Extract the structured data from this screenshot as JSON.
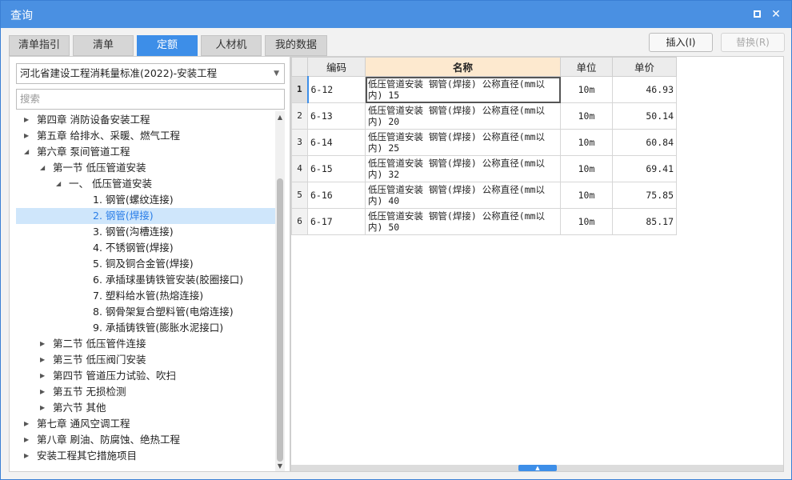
{
  "window": {
    "title": "查询"
  },
  "tabs": [
    {
      "label": "清单指引",
      "active": false
    },
    {
      "label": "清单",
      "active": false
    },
    {
      "label": "定额",
      "active": true
    },
    {
      "label": "人材机",
      "active": false
    },
    {
      "label": "我的数据",
      "active": false
    }
  ],
  "buttons": {
    "insert": "插入(I)",
    "replace": "替换(R)"
  },
  "standard_select": {
    "value": "河北省建设工程消耗量标准(2022)-安装工程"
  },
  "search": {
    "placeholder": "搜索"
  },
  "tree": [
    {
      "label": "第四章 消防设备安装工程",
      "level": 0,
      "arrow": "right",
      "selected": false
    },
    {
      "label": "第五章 给排水、采暖、燃气工程",
      "level": 0,
      "arrow": "right",
      "selected": false
    },
    {
      "label": "第六章 泵间管道工程",
      "level": 0,
      "arrow": "down",
      "selected": false
    },
    {
      "label": "第一节 低压管道安装",
      "level": 1,
      "arrow": "down",
      "selected": false
    },
    {
      "label": "一、 低压管道安装",
      "level": 2,
      "arrow": "down",
      "selected": false
    },
    {
      "label": "1. 钢管(螺纹连接)",
      "level": 3,
      "arrow": "",
      "selected": false
    },
    {
      "label": "2. 钢管(焊接)",
      "level": 3,
      "arrow": "",
      "selected": true
    },
    {
      "label": "3. 钢管(沟槽连接)",
      "level": 3,
      "arrow": "",
      "selected": false
    },
    {
      "label": "4. 不锈钢管(焊接)",
      "level": 3,
      "arrow": "",
      "selected": false
    },
    {
      "label": "5. 铜及铜合金管(焊接)",
      "level": 3,
      "arrow": "",
      "selected": false
    },
    {
      "label": "6. 承插球墨铸铁管安装(胶圈接口)",
      "level": 3,
      "arrow": "",
      "selected": false
    },
    {
      "label": "7. 塑料给水管(热熔连接)",
      "level": 3,
      "arrow": "",
      "selected": false
    },
    {
      "label": "8. 钢骨架复合塑料管(电熔连接)",
      "level": 3,
      "arrow": "",
      "selected": false
    },
    {
      "label": "9. 承插铸铁管(膨胀水泥接口)",
      "level": 3,
      "arrow": "",
      "selected": false
    },
    {
      "label": "第二节 低压管件连接",
      "level": 1,
      "arrow": "right",
      "selected": false
    },
    {
      "label": "第三节 低压阀门安装",
      "level": 1,
      "arrow": "right",
      "selected": false
    },
    {
      "label": "第四节 管道压力试验、吹扫",
      "level": 1,
      "arrow": "right",
      "selected": false
    },
    {
      "label": "第五节 无损检测",
      "level": 1,
      "arrow": "right",
      "selected": false
    },
    {
      "label": "第六节 其他",
      "level": 1,
      "arrow": "right",
      "selected": false
    },
    {
      "label": "第七章 通风空调工程",
      "level": 0,
      "arrow": "right",
      "selected": false
    },
    {
      "label": "第八章 刷油、防腐蚀、绝热工程",
      "level": 0,
      "arrow": "right",
      "selected": false
    },
    {
      "label": "安装工程其它措施项目",
      "level": 0,
      "arrow": "right",
      "selected": false
    }
  ],
  "table": {
    "headers": {
      "code": "编码",
      "name": "名称",
      "unit": "单位",
      "price": "单价"
    },
    "rows": [
      {
        "no": "1",
        "code": "6-12",
        "name": "低压管道安装 钢管(焊接) 公称直径(mm以内) 15",
        "unit": "10m",
        "price": "46.93",
        "current": true
      },
      {
        "no": "2",
        "code": "6-13",
        "name": "低压管道安装 钢管(焊接) 公称直径(mm以内) 20",
        "unit": "10m",
        "price": "50.14",
        "current": false
      },
      {
        "no": "3",
        "code": "6-14",
        "name": "低压管道安装 钢管(焊接) 公称直径(mm以内) 25",
        "unit": "10m",
        "price": "60.84",
        "current": false
      },
      {
        "no": "4",
        "code": "6-15",
        "name": "低压管道安装 钢管(焊接) 公称直径(mm以内) 32",
        "unit": "10m",
        "price": "69.41",
        "current": false
      },
      {
        "no": "5",
        "code": "6-16",
        "name": "低压管道安装 钢管(焊接) 公称直径(mm以内) 40",
        "unit": "10m",
        "price": "75.85",
        "current": false
      },
      {
        "no": "6",
        "code": "6-17",
        "name": "低压管道安装 钢管(焊接) 公称直径(mm以内) 50",
        "unit": "10m",
        "price": "85.17",
        "current": false
      }
    ]
  },
  "colors": {
    "accent": "#3d8ee8",
    "titlebar": "#4a90e2",
    "selected_row": "#cfe6fb",
    "name_header": "#fde9cf"
  }
}
